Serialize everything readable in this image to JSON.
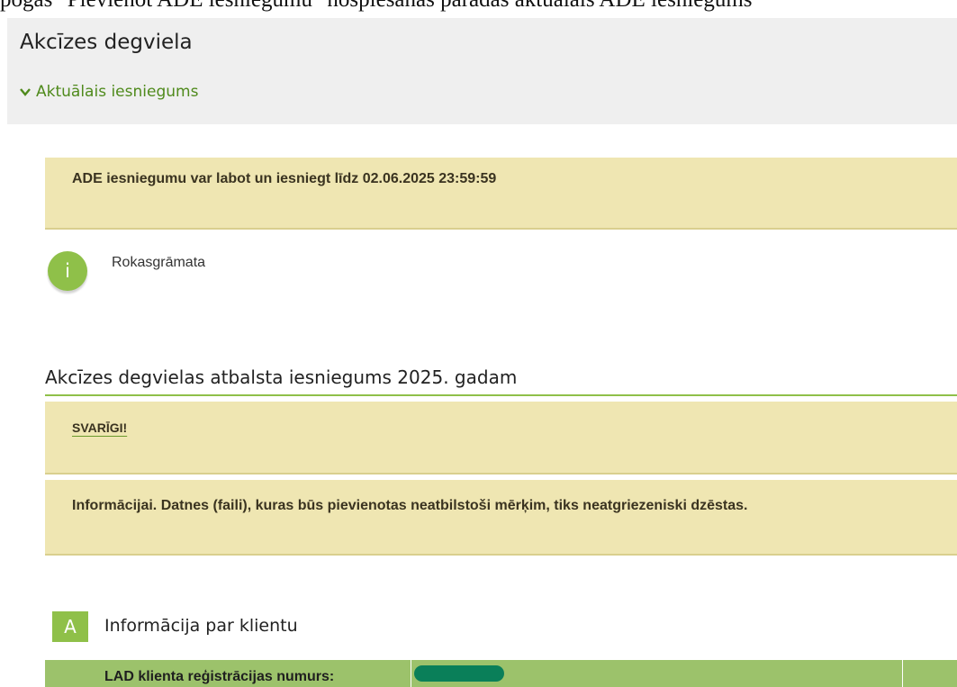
{
  "top_strip_text": "pogas \"Pievienot ADE iesniegumu\" nospiešanas parādās aktuālais ADE iesniegums",
  "header": {
    "title": "Akcīzes degviela",
    "expander_label": "Aktuālais iesniegums"
  },
  "deadline_notice": "ADE iesniegumu var labot un iesniegt līdz 02.06.2025 23:59:59",
  "manual_link": "Rokasgrāmata",
  "info_icon_glyph": "i",
  "section": {
    "title": "Akcīzes degvielas atbalsta iesniegums 2025. gadam",
    "important_label": "SVARĪGI!",
    "info_notice": "Informācijai. Datnes (faili), kuras būs pievienotas neatbilstoši mērķim, tiks neatgriezeniski dzēstas."
  },
  "client_section": {
    "badge": "A",
    "title": "Informācija par klientu",
    "row_label": "LAD klienta reģistrācijas numurs:"
  },
  "colors": {
    "accent_green": "#8fc049",
    "link_green": "#4f8a1c",
    "notice_bg": "#efe6b2",
    "redaction": "#0a7f59"
  }
}
